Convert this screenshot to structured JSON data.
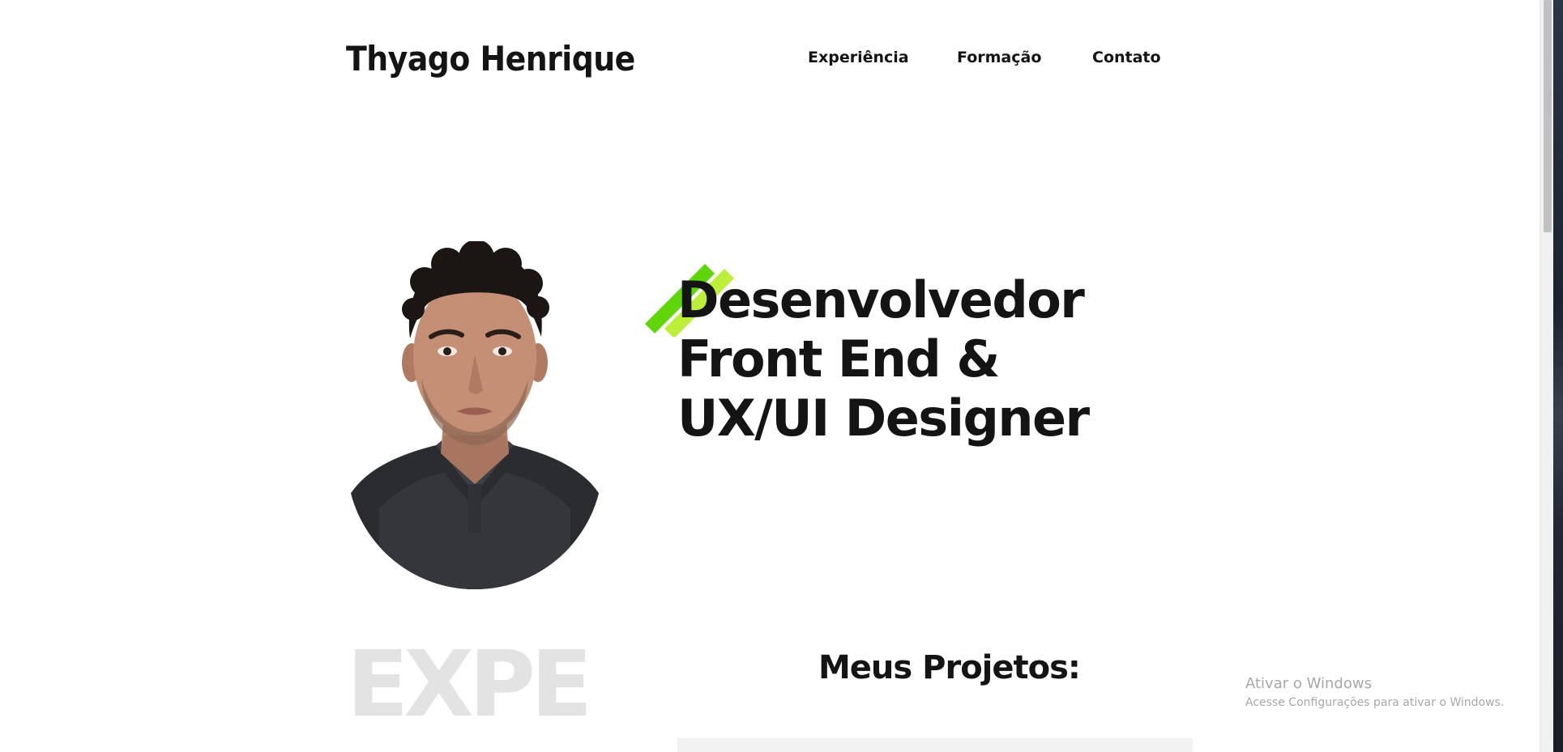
{
  "header": {
    "brand": "Thyago Henrique",
    "nav": [
      {
        "label": "Experiência"
      },
      {
        "label": "Formação"
      },
      {
        "label": "Contato"
      }
    ]
  },
  "hero": {
    "headline_lines": [
      "Desenvolvedor",
      "Front End &",
      "UX/UI Designer"
    ],
    "accent_colors": [
      "#5fd60a",
      "#b8ee2e"
    ]
  },
  "sections": {
    "watermark_word": "EXPE",
    "projects_title": "Meus Projetos:"
  },
  "windows_activation": {
    "title": "Ativar o Windows",
    "subtitle": "Acesse Configurações para ativar o Windows."
  }
}
